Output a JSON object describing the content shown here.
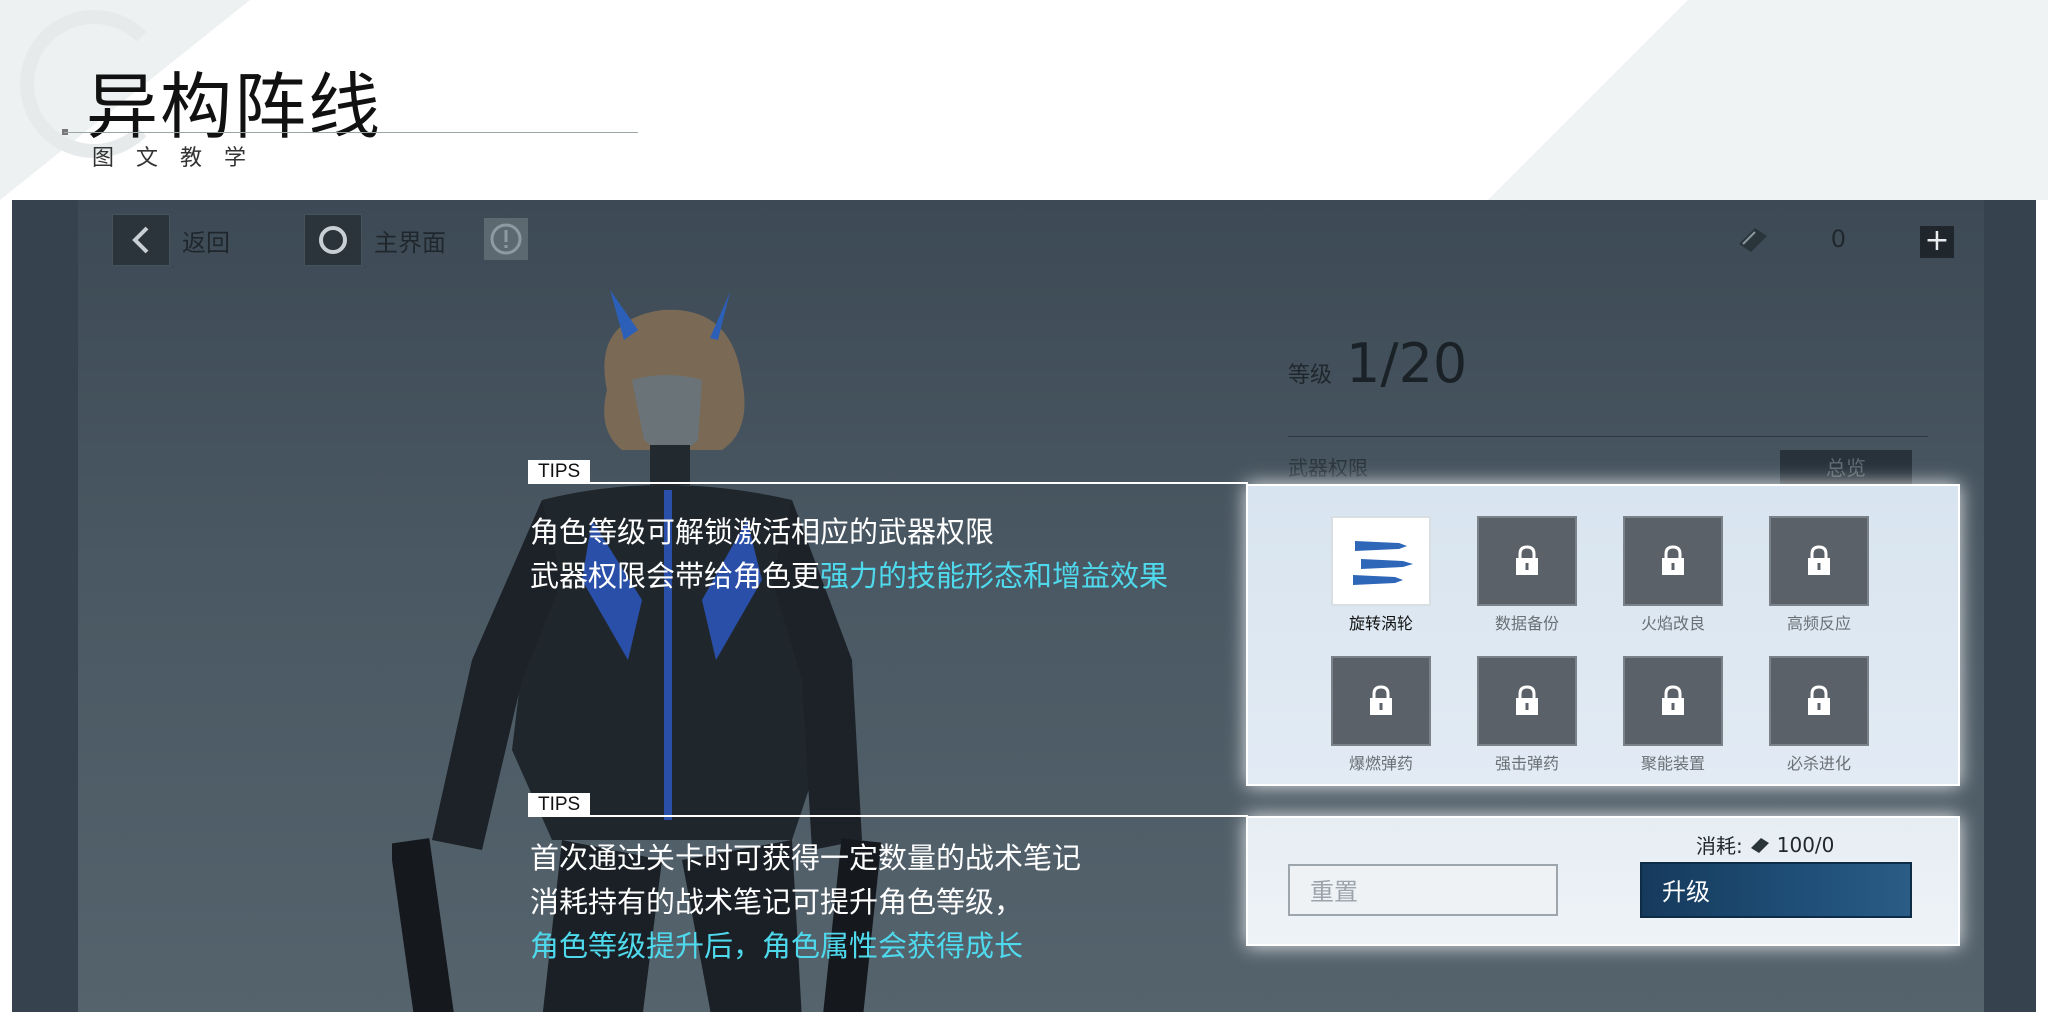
{
  "header": {
    "title": "异构阵线",
    "subtitle": "图文教学"
  },
  "topbar": {
    "back_label": "返回",
    "home_label": "主界面",
    "currency_value": "0",
    "plus_label": "+"
  },
  "character": {
    "level_label": "等级",
    "level_value": "1/20",
    "permissions_title": "武器权限",
    "overview_label": "总览"
  },
  "tips": {
    "tag": "TIPS",
    "tip1": {
      "line1": "角色等级可解锁激活相应的武器权限",
      "line2_plain": "武器权限会带给角色更",
      "line2_highlight": "强力的技能形态和增益效果"
    },
    "tip2": {
      "line1": "首次通过关卡时可获得一定数量的战术笔记",
      "line2": "消耗持有的战术笔记可提升角色等级，",
      "line3_highlight": "角色等级提升后，角色属性会获得成长"
    }
  },
  "permissions": [
    {
      "name": "旋转涡轮",
      "locked": false,
      "icon": "missiles-icon"
    },
    {
      "name": "数据备份",
      "locked": true,
      "icon": "lock-icon"
    },
    {
      "name": "火焰改良",
      "locked": true,
      "icon": "lock-icon"
    },
    {
      "name": "高频反应",
      "locked": true,
      "icon": "lock-icon"
    },
    {
      "name": "爆燃弹药",
      "locked": true,
      "icon": "lock-icon"
    },
    {
      "name": "强击弹药",
      "locked": true,
      "icon": "lock-icon"
    },
    {
      "name": "聚能装置",
      "locked": true,
      "icon": "lock-icon"
    },
    {
      "name": "必杀进化",
      "locked": true,
      "icon": "lock-icon"
    }
  ],
  "upgrade": {
    "cost_label": "消耗:",
    "cost_value": "100/0",
    "reset_label": "重置",
    "upgrade_label": "升级"
  },
  "colors": {
    "highlight": "#4fd9ec",
    "upgrade_button": "#1f4f78",
    "game_bg": "#4a5863"
  }
}
